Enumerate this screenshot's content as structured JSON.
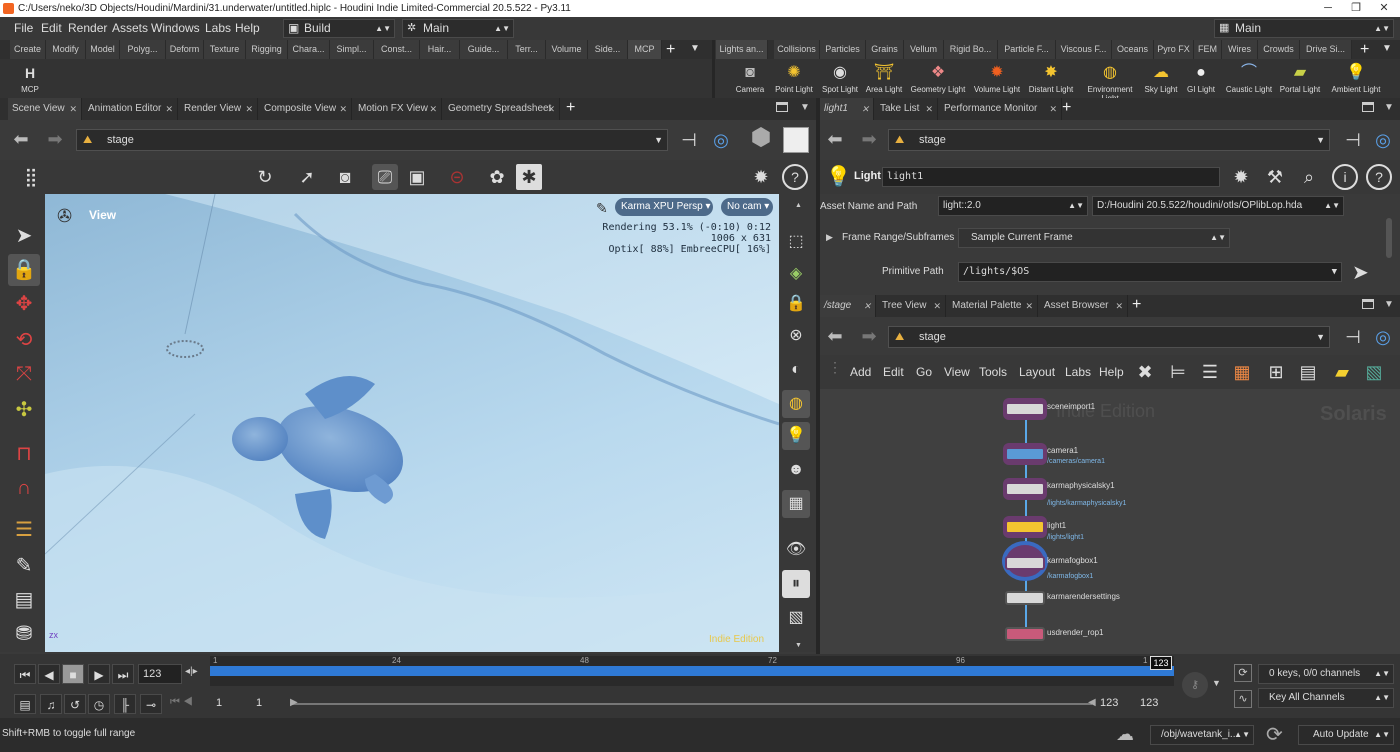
{
  "title": "C:/Users/neko/3D Objects/Houdini/Mardini/31.underwater/untitled.hiplc - Houdini Indie Limited-Commercial 20.5.522 - Py3.11",
  "menus": [
    "File",
    "Edit",
    "Render",
    "Assets",
    "Windows",
    "Labs",
    "Help"
  ],
  "desktop_build": "Build",
  "desktop_main": "Main",
  "desktop_right": "Main",
  "shelf_tabs_left": [
    "Create",
    "Modify",
    "Model",
    "Polyg...",
    "Deform",
    "Texture",
    "Rigging",
    "Chara...",
    "Simpl...",
    "Const...",
    "Hair...",
    "Guide...",
    "Terr...",
    "Volume",
    "Side...",
    "MCP"
  ],
  "shelf_tabs_right": [
    "Lights an...",
    "Collisions",
    "Particles",
    "Grains",
    "Vellum",
    "Rigid Bo...",
    "Particle F...",
    "Viscous F...",
    "Oceans",
    "Pyro FX",
    "FEM",
    "Wires",
    "Crowds",
    "Drive Si..."
  ],
  "mcp_tool": "MCP",
  "light_tools": [
    "Camera",
    "Point Light",
    "Spot Light",
    "Area Light",
    "Geometry Light",
    "Volume Light",
    "Distant Light",
    "Environment Light",
    "Sky Light",
    "GI Light",
    "Caustic Light",
    "Portal Light",
    "Ambient Light"
  ],
  "left_tabs": [
    "Scene View",
    "Animation Editor",
    "Render View",
    "Composite View",
    "Motion FX View",
    "Geometry Spreadsheet"
  ],
  "left_path": "stage",
  "viewport": {
    "label": "View",
    "renderer": "Karma XPU",
    "persp": "Persp",
    "cam": "No cam",
    "stats1": "Rendering  53.1%  (-0:10)  0:12",
    "stats2": "1006 x 631",
    "stats3": "Optix[ 88%] EmbreeCPU[ 16%]",
    "watermark": "Indie Edition"
  },
  "param_tabs": [
    "light1",
    "Take List",
    "Performance Monitor"
  ],
  "param_path": "stage",
  "param": {
    "type": "Light",
    "name": "light1",
    "asset_label": "Asset Name and Path",
    "asset_name": "light::2.0",
    "asset_path": "D:/Houdini 20.5.522/houdini/otls/OPlibLop.hda",
    "frame_range_label": "Frame Range/Subframes",
    "frame_range_value": "Sample Current Frame",
    "prim_label": "Primitive Path",
    "prim_value": "/lights/$OS"
  },
  "network_tabs": [
    "/stage",
    "Tree View",
    "Material Palette",
    "Asset Browser"
  ],
  "network_path": "stage",
  "network_menus": [
    "Add",
    "Edit",
    "Go",
    "View",
    "Tools",
    "Layout",
    "Labs",
    "Help"
  ],
  "network_watermark1": "Indie Edition",
  "network_watermark2": "Solaris",
  "nodes": [
    {
      "name": "sceneimport1",
      "path": ""
    },
    {
      "name": "camera1",
      "path": "/cameras/camera1"
    },
    {
      "name": "karmaphysicalsky1",
      "path": "/lights/karmaphysicalsky1"
    },
    {
      "name": "light1",
      "path": "/lights/light1"
    },
    {
      "name": "karmafogbox1",
      "path": "/karmafogbox1"
    },
    {
      "name": "karmarendersettings",
      "path": ""
    },
    {
      "name": "usdrender_rop1",
      "path": ""
    }
  ],
  "timeline": {
    "frame": "123",
    "ticks": [
      "1",
      "24",
      "48",
      "72",
      "96",
      "1"
    ],
    "current_marker": "123",
    "range_start": "1",
    "range_start2": "1",
    "range_end": "123",
    "range_end2": "123",
    "keys": "0 keys, 0/0 channels",
    "key_all": "Key All Channels",
    "progress": 0.935
  },
  "status": {
    "hint": "Shift+RMB to toggle full range",
    "obj_path": "/obj/wavetank_i...",
    "auto_update": "Auto Update"
  },
  "colors": {
    "accent": "#2f7ad6",
    "node_border": "#6a3b6e",
    "path_blue": "#7fb8e8",
    "watermark": "#e8c84a"
  }
}
